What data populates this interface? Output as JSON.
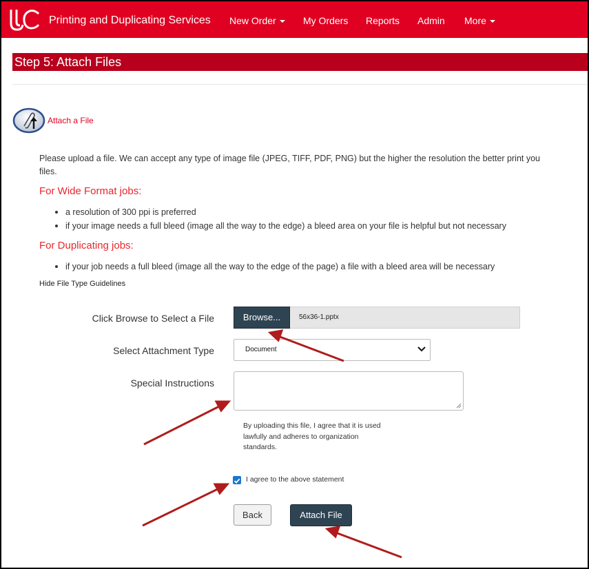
{
  "navbar": {
    "brand": "Printing and Duplicating Services",
    "items": [
      {
        "label": "New Order",
        "dropdown": true
      },
      {
        "label": "My Orders",
        "dropdown": false
      },
      {
        "label": "Reports",
        "dropdown": false
      },
      {
        "label": "Admin",
        "dropdown": false
      },
      {
        "label": "More",
        "dropdown": true
      }
    ],
    "color": "#e00122"
  },
  "step": {
    "title": "Step 5: Attach Files",
    "color": "#b8001c"
  },
  "attach": {
    "link_label": "Attach a File",
    "icon": "paperclip-upload-icon"
  },
  "guidelines": {
    "intro_line1": "Please upload a file. We can accept any type of image file (JPEG, TIFF, PDF, PNG) but the higher the resolution the better print you",
    "intro_line2": "files.",
    "wide_format": {
      "heading": "For Wide Format jobs:",
      "bullets": [
        "a resolution of 300 ppi is preferred",
        "if your image needs a full bleed (image all the way to the edge) a bleed area on your file is helpful but not necessary"
      ]
    },
    "duplicating": {
      "heading": "For Duplicating jobs:",
      "bullets": [
        "if your job needs a full bleed (image all the way to the edge of the page) a file with a bleed area will be necessary"
      ]
    },
    "hide_link": "Hide File Type Guidelines"
  },
  "form": {
    "file_label": "Click Browse to Select a File",
    "browse_label": "Browse...",
    "file_name": "56x36-1.pptx",
    "attachment_type_label": "Select Attachment Type",
    "attachment_type_value": "Document",
    "instructions_label": "Special Instructions",
    "instructions_value": "",
    "agreement_text": "By uploading this file, I agree that it is used lawfully and adheres to organization standards.",
    "agree_checkbox_label": "I agree to the above statement",
    "agree_checked": true,
    "back_label": "Back",
    "attach_label": "Attach File"
  },
  "annotation_arrow_color": "#b01c1c"
}
